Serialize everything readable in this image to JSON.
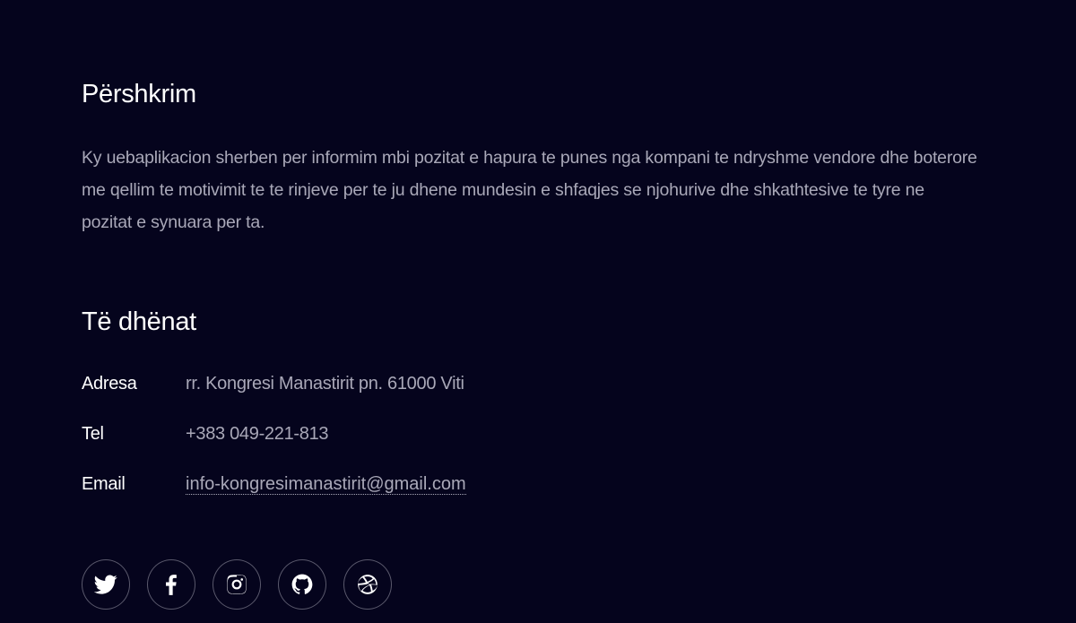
{
  "description_section": {
    "title": "Përshkrim",
    "text": "Ky uebaplikacion sherben per informim mbi pozitat e hapura te punes nga kompani te ndryshme vendore dhe boterore me qellim te motivimit te te rinjeve per te ju dhene mundesin e shfaqjes se njohurive dhe shkathtesive te tyre ne pozitat e synuara per ta."
  },
  "info_section": {
    "title": "Të dhënat",
    "address": {
      "label": "Adresa",
      "value": "rr. Kongresi Manastirit pn. 61000 Viti"
    },
    "tel": {
      "label": "Tel",
      "value": "+383 049-221-813"
    },
    "email": {
      "label": "Email",
      "value": "info-kongresimanastirit@gmail.com"
    }
  },
  "socials": [
    {
      "icon": "twitter-icon"
    },
    {
      "icon": "facebook-icon"
    },
    {
      "icon": "instagram-icon"
    },
    {
      "icon": "github-icon"
    },
    {
      "icon": "dribbble-icon"
    }
  ],
  "colors": {
    "background": "#05041d",
    "heading": "#ffffff",
    "muted_text": "#a9a8b8",
    "social_border": "#5a596c"
  }
}
